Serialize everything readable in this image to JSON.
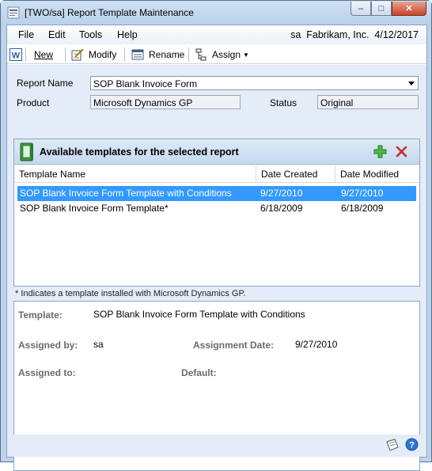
{
  "window": {
    "title": "[TWO/sa] Report Template Maintenance"
  },
  "menu": {
    "items": [
      "File",
      "Edit",
      "Tools",
      "Help"
    ],
    "user": "sa",
    "company": "Fabrikam, Inc.",
    "date": "4/12/2017"
  },
  "toolbar": {
    "new_label": "New",
    "modify_label": "Modify",
    "rename_label": "Rename",
    "assign_label": "Assign"
  },
  "form": {
    "report_name_label": "Report Name",
    "report_name_value": "SOP Blank Invoice Form",
    "product_label": "Product",
    "product_value": "Microsoft Dynamics GP",
    "status_label": "Status",
    "status_value": "Original"
  },
  "templates_panel": {
    "title": "Available templates for the selected report",
    "columns": [
      "Template Name",
      "Date Created",
      "Date Modified"
    ],
    "rows": [
      {
        "name": "SOP Blank Invoice Form Template with Conditions",
        "created": "9/27/2010",
        "modified": "9/27/2010",
        "selected": true
      },
      {
        "name": "SOP Blank Invoice Form Template*",
        "created": "6/18/2009",
        "modified": "6/18/2009",
        "selected": false
      }
    ]
  },
  "note": "* Indicates a template installed with Microsoft Dynamics GP.",
  "details": {
    "template_label": "Template:",
    "template_value": "SOP Blank Invoice Form Template with Conditions",
    "assigned_by_label": "Assigned by:",
    "assigned_by_value": "sa",
    "assignment_date_label": "Assignment Date:",
    "assignment_date_value": "9/27/2010",
    "assigned_to_label": "Assigned to:",
    "default_label": "Default:"
  },
  "colors": {
    "selection": "#3399ff",
    "form_background": "#e4ecf7",
    "panel_header": "#c6d9ef"
  }
}
